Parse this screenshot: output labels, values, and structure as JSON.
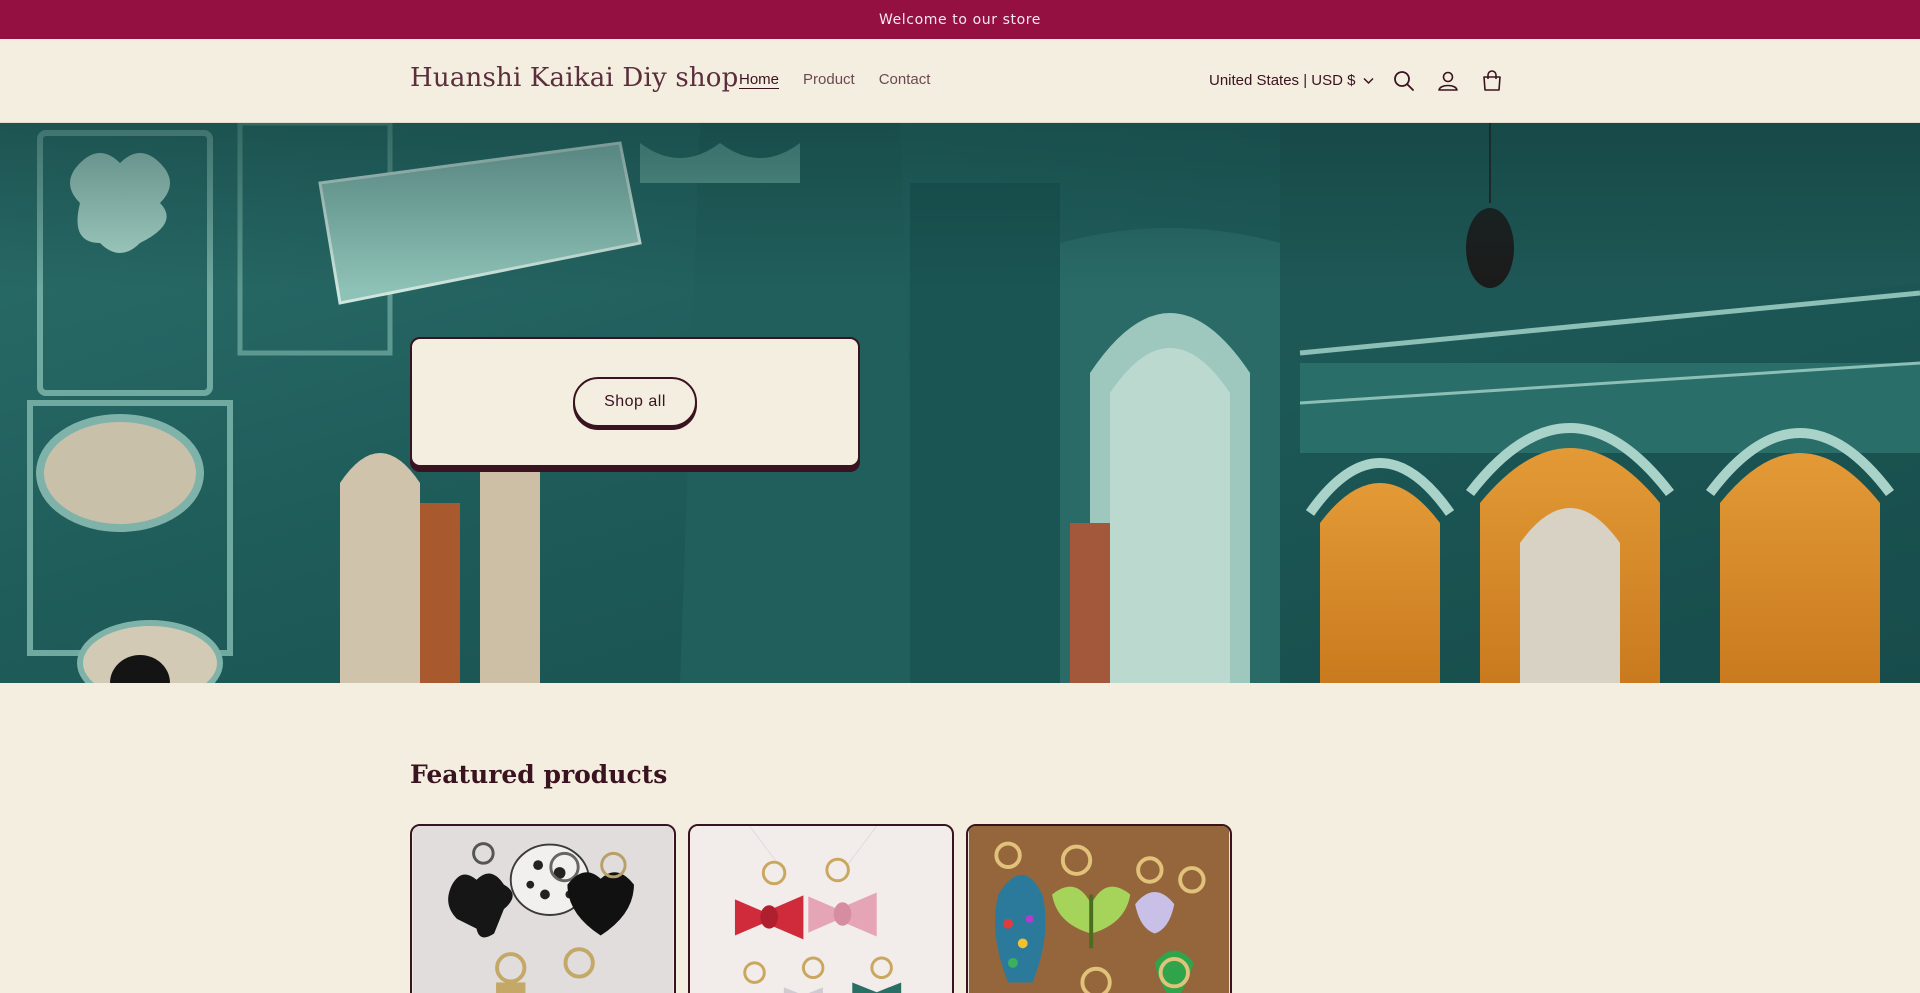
{
  "announcement": "Welcome to our store",
  "header": {
    "logo": "Huanshi Kaikai Diy shop",
    "nav": [
      "Home",
      "Product",
      "Contact"
    ],
    "locale": "United States | USD $",
    "icons": [
      "search-icon",
      "account-icon",
      "cart-icon"
    ]
  },
  "hero": {
    "button_label": "Shop all"
  },
  "featured": {
    "title": "Featured products"
  },
  "colors": {
    "announcement_bar": "#931040",
    "background": "#f3eee0",
    "text": "#3a1320",
    "hero_teal": "#1f5d5a"
  }
}
